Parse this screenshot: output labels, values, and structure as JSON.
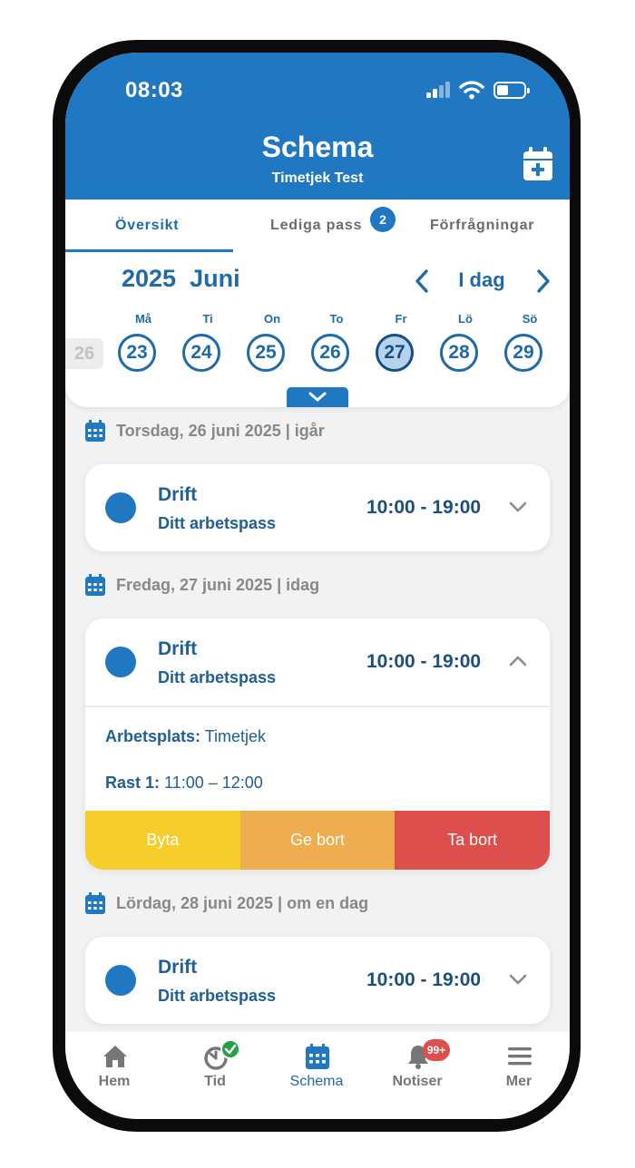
{
  "status_bar": {
    "time": "08:03"
  },
  "header": {
    "title": "Schema",
    "subtitle": "Timetjek Test",
    "add_icon": "calendar-plus-icon"
  },
  "tabs": [
    {
      "label": "Översikt",
      "active": true
    },
    {
      "label": "Lediga pass",
      "badge": "2"
    },
    {
      "label": "Förfrågningar"
    }
  ],
  "calendar": {
    "year": "2025",
    "month": "Juni",
    "today_label": "I dag",
    "prev_week_day": "26",
    "weekdays": [
      "Må",
      "Ti",
      "On",
      "To",
      "Fr",
      "Lö",
      "Sö"
    ],
    "days": [
      "23",
      "24",
      "25",
      "26",
      "27",
      "28",
      "29"
    ],
    "selected_day": "27"
  },
  "days": [
    {
      "header": "Torsdag, 26 juni 2025 | igår",
      "shift": {
        "title": "Drift",
        "subtitle": "Ditt arbetspass",
        "time": "10:00 - 19:00"
      }
    },
    {
      "header": "Fredag, 27 juni 2025 | idag",
      "shift": {
        "title": "Drift",
        "subtitle": "Ditt arbetspass",
        "time": "10:00 - 19:00",
        "workplace_label": "Arbetsplats:",
        "workplace": "Timetjek",
        "break_label": "Rast 1:",
        "break_time": "11:00 – 12:00",
        "actions": [
          "Byta",
          "Ge bort",
          "Ta bort"
        ]
      }
    },
    {
      "header": "Lördag, 28 juni 2025 | om en dag",
      "shift": {
        "title": "Drift",
        "subtitle": "Ditt arbetspass",
        "time": "10:00 - 19:00"
      }
    }
  ],
  "bottom_nav": [
    {
      "label": "Hem",
      "icon": "home-icon"
    },
    {
      "label": "Tid",
      "icon": "timer-icon"
    },
    {
      "label": "Schema",
      "icon": "calendar-icon",
      "active": true
    },
    {
      "label": "Notiser",
      "icon": "bell-icon",
      "badge": "99+"
    },
    {
      "label": "Mer",
      "icon": "menu-icon"
    }
  ],
  "colors": {
    "brand_blue": "#1f78c1",
    "dark_blue": "#1f5f96",
    "swap_yellow": "#f6cd2a",
    "give_orange": "#eead4e",
    "delete_red": "#dd4f4c",
    "success_green": "#27a146"
  }
}
